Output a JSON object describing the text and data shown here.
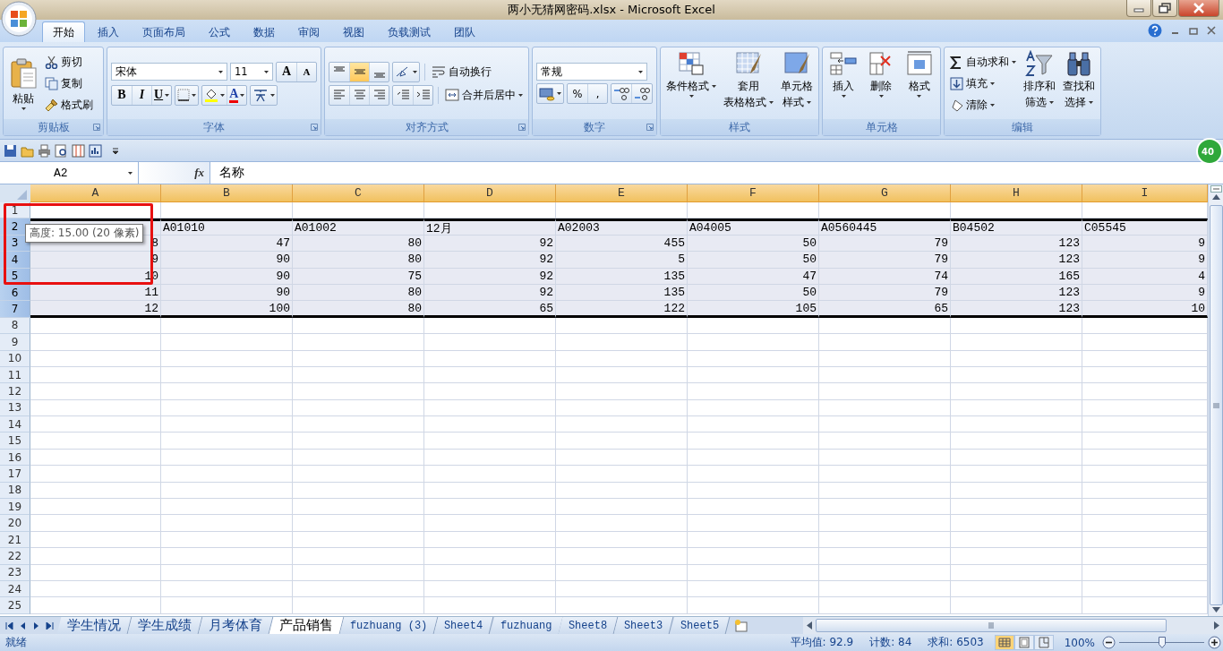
{
  "window": {
    "title": "两小无猜网密码.xlsx - Microsoft Excel"
  },
  "ribbon_tabs": [
    {
      "label": "开始",
      "selected": true
    },
    {
      "label": "插入",
      "selected": false
    },
    {
      "label": "页面布局",
      "selected": false
    },
    {
      "label": "公式",
      "selected": false
    },
    {
      "label": "数据",
      "selected": false
    },
    {
      "label": "审阅",
      "selected": false
    },
    {
      "label": "视图",
      "selected": false
    },
    {
      "label": "负载测试",
      "selected": false
    },
    {
      "label": "团队",
      "selected": false
    }
  ],
  "ribbon": {
    "clipboard": {
      "paste": "粘贴",
      "items": [
        "剪切",
        "复制",
        "格式刷"
      ],
      "label": "剪贴板"
    },
    "font": {
      "font_name": "宋体",
      "font_size": "11",
      "grow": "A",
      "shrink": "A",
      "bold": "B",
      "italic": "I",
      "underline": "U",
      "font_color": "A",
      "label": "字体"
    },
    "alignment": {
      "vertical_align": [
        {
          "selected": false
        },
        {
          "selected": true
        },
        {
          "selected": false
        }
      ],
      "wrap": "自动换行",
      "merge": "合并后居中",
      "label": "对齐方式"
    },
    "number": {
      "format": "常规",
      "percent": "%",
      "comma": ",",
      "label": "数字"
    },
    "styles": {
      "items": [
        [
          "条件格式"
        ],
        [
          "套用",
          "表格格式"
        ],
        [
          "单元格",
          "样式"
        ]
      ],
      "label": "样式"
    },
    "cells": {
      "items": [
        "插入",
        "删除",
        "格式"
      ],
      "label": "单元格"
    },
    "editing": {
      "small": [
        "自动求和",
        "填充",
        "清除"
      ],
      "large": [
        [
          "排序和",
          "筛选"
        ],
        [
          "查找和",
          "选择"
        ]
      ],
      "label": "编辑"
    }
  },
  "name_box": "A2",
  "function_button": "fx",
  "formula": "名称",
  "badge": "40",
  "columns": [
    {
      "label": "A",
      "selected": true
    },
    {
      "label": "B",
      "selected": true
    },
    {
      "label": "C",
      "selected": true
    },
    {
      "label": "D",
      "selected": true
    },
    {
      "label": "E",
      "selected": true
    },
    {
      "label": "F",
      "selected": true
    },
    {
      "label": "G",
      "selected": true
    },
    {
      "label": "H",
      "selected": true
    },
    {
      "label": "I",
      "selected": true
    }
  ],
  "row_numbers": [
    {
      "label": "1",
      "selected": false,
      "kind": "blank"
    },
    {
      "label": "2",
      "selected": true,
      "kind": "header",
      "cells": [
        "A01010",
        "A01002",
        "12月",
        "A02003",
        "A04005",
        "A0560445",
        "B04502",
        "C05545"
      ]
    },
    {
      "label": "3",
      "selected": true,
      "kind": "number",
      "cells": [
        "8",
        "47",
        "80",
        "92",
        "455",
        "50",
        "79",
        "123",
        "9"
      ]
    },
    {
      "label": "4",
      "selected": true,
      "kind": "number",
      "cells": [
        "9",
        "90",
        "80",
        "92",
        "5",
        "50",
        "79",
        "123",
        "9"
      ]
    },
    {
      "label": "5",
      "selected": true,
      "kind": "number",
      "cells": [
        "10",
        "90",
        "75",
        "92",
        "135",
        "47",
        "74",
        "165",
        "4"
      ]
    },
    {
      "label": "6",
      "selected": true,
      "kind": "number",
      "cells": [
        "11",
        "90",
        "80",
        "92",
        "135",
        "50",
        "79",
        "123",
        "9"
      ]
    },
    {
      "label": "7",
      "selected": true,
      "kind": "number",
      "cells": [
        "12",
        "100",
        "80",
        "65",
        "122",
        "105",
        "65",
        "123",
        "10"
      ]
    },
    {
      "label": "8",
      "selected": false,
      "kind": "blank"
    },
    {
      "label": "9",
      "selected": false,
      "kind": "blank"
    },
    {
      "label": "10",
      "selected": false,
      "kind": "blank"
    },
    {
      "label": "11",
      "selected": false,
      "kind": "blank"
    },
    {
      "label": "12",
      "selected": false,
      "kind": "blank"
    },
    {
      "label": "13",
      "selected": false,
      "kind": "blank"
    },
    {
      "label": "14",
      "selected": false,
      "kind": "blank"
    },
    {
      "label": "15",
      "selected": false,
      "kind": "blank"
    },
    {
      "label": "16",
      "selected": false,
      "kind": "blank"
    },
    {
      "label": "17",
      "selected": false,
      "kind": "blank"
    },
    {
      "label": "18",
      "selected": false,
      "kind": "blank"
    },
    {
      "label": "19",
      "selected": false,
      "kind": "blank"
    },
    {
      "label": "20",
      "selected": false,
      "kind": "blank"
    },
    {
      "label": "21",
      "selected": false,
      "kind": "blank"
    },
    {
      "label": "22",
      "selected": false,
      "kind": "blank"
    },
    {
      "label": "23",
      "selected": false,
      "kind": "blank"
    },
    {
      "label": "24",
      "selected": false,
      "kind": "blank"
    },
    {
      "label": "25",
      "selected": false,
      "kind": "blank"
    }
  ],
  "tooltip": "高度: 15.00 (20 像素)",
  "sheet_tabs": [
    {
      "label": "学生情况",
      "selected": false,
      "kind": "cjk"
    },
    {
      "label": "学生成绩",
      "selected": false,
      "kind": "cjk"
    },
    {
      "label": "月考体育",
      "selected": false,
      "kind": "cjk"
    },
    {
      "label": "产品销售",
      "selected": true,
      "kind": "cjk"
    },
    {
      "label": "fuzhuang (3)",
      "selected": false,
      "kind": "latin"
    },
    {
      "label": "Sheet4",
      "selected": false,
      "kind": "latin"
    },
    {
      "label": "fuzhuang",
      "selected": false,
      "kind": "latin"
    },
    {
      "label": "Sheet8",
      "selected": false,
      "kind": "latin"
    },
    {
      "label": "Sheet3",
      "selected": false,
      "kind": "latin"
    },
    {
      "label": "Sheet5",
      "selected": false,
      "kind": "latin"
    }
  ],
  "status_bar": {
    "ready": "就绪",
    "average": "平均值: 92.9",
    "count": "计数: 84",
    "sum": "求和: 6503",
    "zoom": "100%",
    "zoom_slider": {
      "level": 0.5
    }
  }
}
